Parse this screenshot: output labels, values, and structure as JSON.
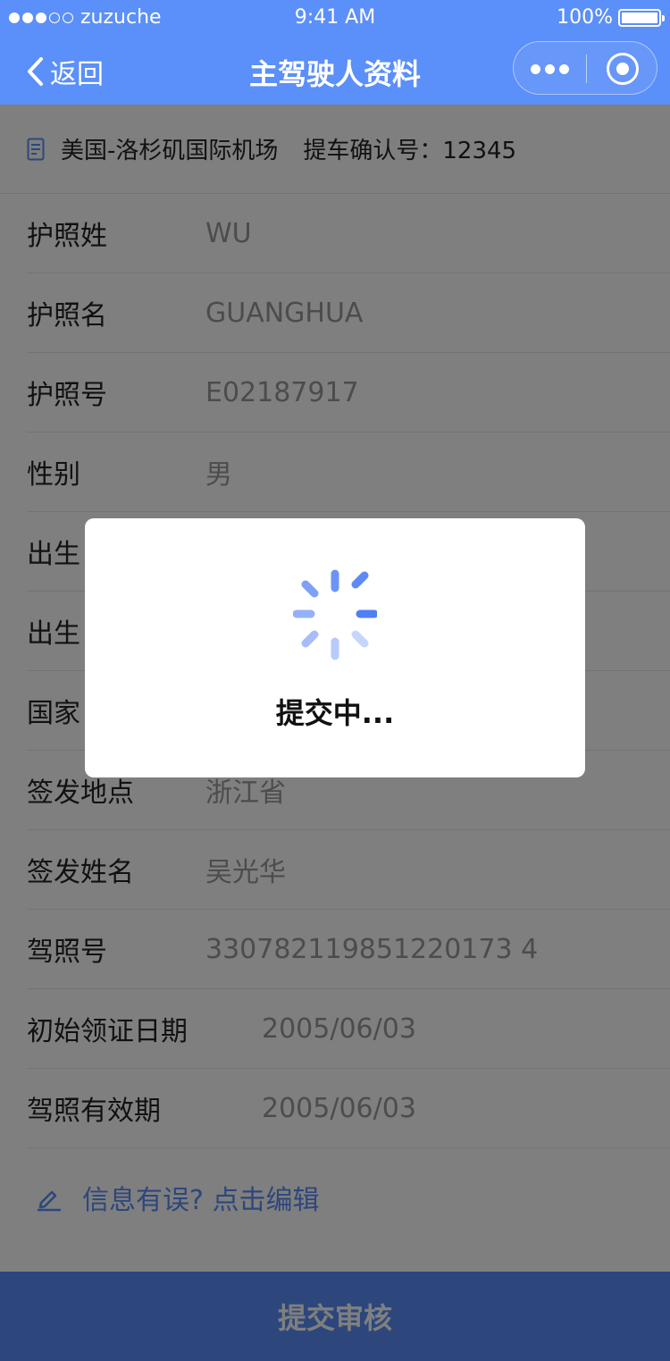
{
  "status_bar": {
    "carrier": "zuzuche",
    "time": "9:41 AM",
    "battery": "100%",
    "battery_level": 1.0
  },
  "nav": {
    "back_label": "返回",
    "title": "主驾驶人资料",
    "color": "#5b8ff9"
  },
  "info_bar": {
    "location": "美国-洛杉矶国际机场",
    "confirm": "提车确认号：12345"
  },
  "fields": [
    {
      "label": "护照姓",
      "value": "WU"
    },
    {
      "label": "护照名",
      "value": "GUANGHUA"
    },
    {
      "label": "护照号",
      "value": "E02187917"
    },
    {
      "label": "性别",
      "value": "男"
    },
    {
      "label": "出生",
      "value": ""
    },
    {
      "label": "出生",
      "value": ""
    },
    {
      "label": "国家",
      "value": ""
    },
    {
      "label": "签发地点",
      "value": "浙江省"
    },
    {
      "label": "签发姓名",
      "value": "吴光华"
    },
    {
      "label": "驾照号",
      "value": "330782119851220173 4"
    },
    {
      "label": "初始领证日期",
      "value": "2005/06/03"
    },
    {
      "label": "驾照有效期",
      "value": "2005/06/03"
    }
  ],
  "edit_link": "信息有误? 点击编辑",
  "submit_label": "提交审核",
  "toast": {
    "text": "提交中..."
  },
  "icons": {
    "back": "chevron-left-icon",
    "more": "more-dots-icon",
    "close": "target-icon",
    "doc": "document-icon",
    "edit": "pencil-icon",
    "spinner": "spinner-icon"
  }
}
